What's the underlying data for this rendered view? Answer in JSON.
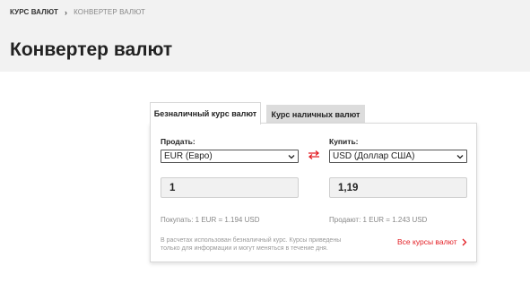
{
  "breadcrumb": {
    "items": [
      "КУРС ВАЛЮТ",
      "КОНВЕРТЕР ВАЛЮТ"
    ]
  },
  "page": {
    "title": "Конвертер валют"
  },
  "tabs": [
    {
      "label": "Безналичный курс валют",
      "active": true
    },
    {
      "label": "Курс наличных валют",
      "active": false
    }
  ],
  "converter": {
    "sell": {
      "label": "Продать:",
      "currency": "EUR (Евро)",
      "amount": "1",
      "rate_text": "Покупать: 1 EUR = 1.194 USD"
    },
    "buy": {
      "label": "Купить:",
      "currency": "USD (Доллар США)",
      "amount": "1,19",
      "rate_text": "Продают: 1 EUR = 1.243 USD"
    },
    "note": "В расчетах использован безналичный курс. Курсы приведены только для информации и могут меняться в течение дня.",
    "all_rates_link": "Все курсы валют"
  },
  "icons": {
    "separator": "chevron-right-icon",
    "swap": "swap-arrows-icon",
    "dropdown": "chevron-down-icon",
    "link_arrow": "chevron-right-icon"
  },
  "colors": {
    "accent": "#e31e24",
    "header_bg": "#f2f2f2",
    "input_bg": "#f1f1f1"
  }
}
